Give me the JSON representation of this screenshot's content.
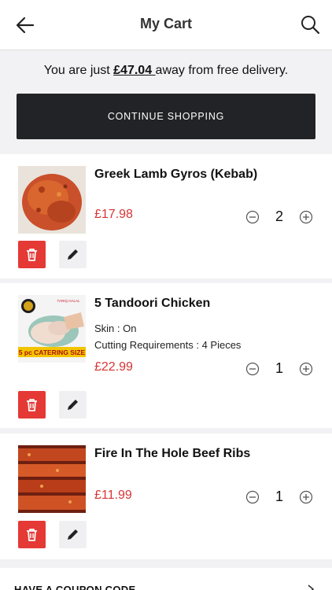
{
  "header": {
    "title": "My Cart",
    "back_icon": "arrow-left-icon",
    "search_icon": "search-icon"
  },
  "delivery": {
    "prefix": "You are just ",
    "amount": "£47.04 ",
    "suffix": "away from free delivery."
  },
  "continue_label": "CONTINUE SHOPPING",
  "items": [
    {
      "name": "Greek Lamb Gyros (Kebab)",
      "price": "£17.98",
      "quantity": "2",
      "options": []
    },
    {
      "name": "5 Tandoori Chicken",
      "price": "£22.99",
      "quantity": "1",
      "options": [
        "Skin : On",
        "Cutting Requirements : 4 Pieces"
      ],
      "thumb_text": {
        "banner": "5 pc CATERING SIZE",
        "brand": "TARIQ HALAL"
      }
    },
    {
      "name": "Fire In The Hole Beef Ribs",
      "price": "£11.99",
      "quantity": "1",
      "options": []
    }
  ],
  "coupon_label": "HAVE A COUPON CODE",
  "colors": {
    "price": "#d83434",
    "delete": "#e53935",
    "button_dark": "#222326"
  }
}
